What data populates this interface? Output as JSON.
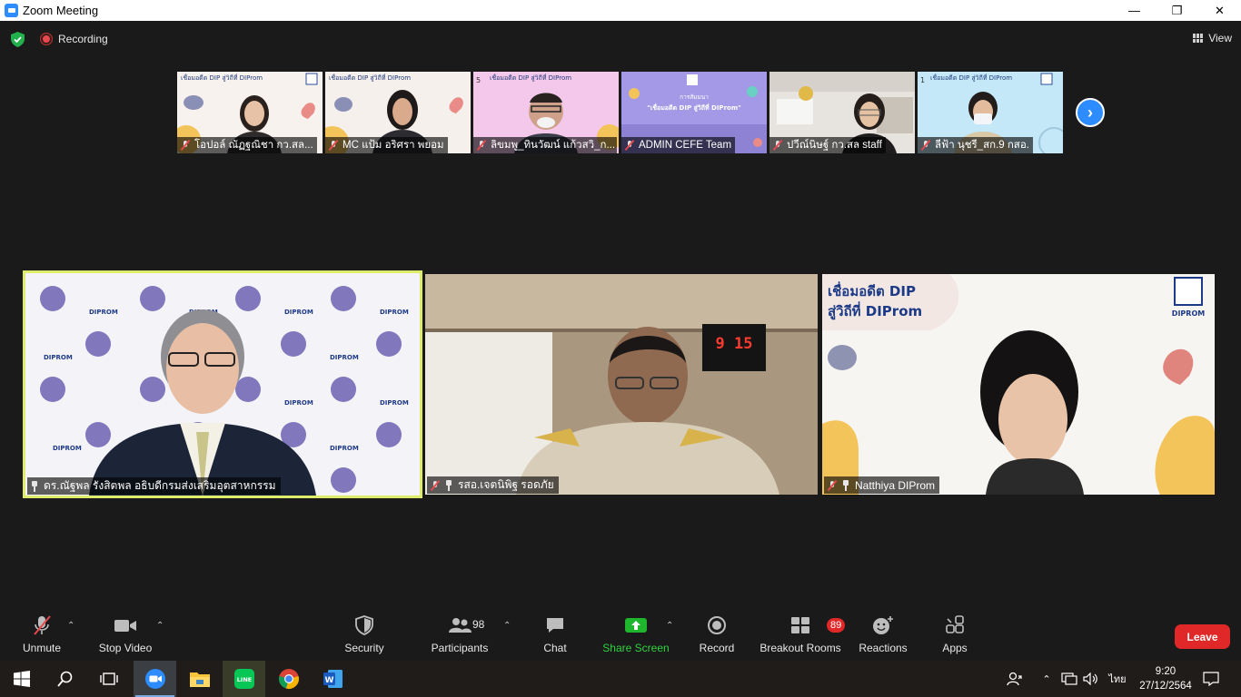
{
  "window": {
    "title": "Zoom Meeting"
  },
  "topbar": {
    "recording_label": "Recording",
    "view_label": "View"
  },
  "thumbnails": [
    {
      "name": "โอปอล์ ณัฏฐณิชา กว.สล...",
      "bg": "#f7f2ee"
    },
    {
      "name": "MC แป้ม อริศรา พยอม",
      "bg": "#f5f0ec"
    },
    {
      "name": "ลิขมพู_ทินวัฒน์ แก้วสวิ_ก...",
      "bg": "#f4c8ea"
    },
    {
      "name": "ADMIN CEFE Team",
      "bg": "#9a8ee0"
    },
    {
      "name": "ปวีณ์นิษฐ์ กว.สล staff",
      "bg": "#e7e4df"
    },
    {
      "name": "ลีฟ้า นุชรี_สก.9 กสอ.",
      "bg": "#bfe6f7"
    }
  ],
  "thumbnail_graphics": {
    "banner": "เชื่อมอดีต DIP สู่วิถีที่ DIProm",
    "admin_title": "การสัมมนา",
    "admin_subtitle": "\"เชื่อมอดีต DIP สู่วิถีที่ DIProm\""
  },
  "speakers": [
    {
      "name": "ดร.ณัฐพล รังสิตพล อธิบดีกรมส่งเสริมอุตสาหกรรม",
      "active": true
    },
    {
      "name": "รสอ.เจตนิพิฐ รอดภัย",
      "active": false
    },
    {
      "name": "Natthiya DIProm",
      "active": false
    }
  ],
  "tile_graphics": {
    "backdrop_logo_text": "DIPROM",
    "clock_value": "9 15",
    "banner_line1": "เชื่อมอดีต DIP",
    "banner_line2": "สู่วิถีที่ DIProm",
    "banner_logo_text": "DIPROM"
  },
  "controls": {
    "unmute": "Unmute",
    "stop_video": "Stop Video",
    "security": "Security",
    "participants": "Participants",
    "participants_count": "98",
    "chat": "Chat",
    "share_screen": "Share Screen",
    "record": "Record",
    "breakout_rooms": "Breakout Rooms",
    "breakout_count": "89",
    "reactions": "Reactions",
    "apps": "Apps",
    "leave": "Leave"
  },
  "taskbar": {
    "lang": "ไทย",
    "time": "9:20",
    "date": "27/12/2564"
  },
  "colors": {
    "accent": "#2d8cff",
    "leave": "#e02828",
    "active_speaker_border": "#dfec6b",
    "share_green": "#1fb52c"
  }
}
